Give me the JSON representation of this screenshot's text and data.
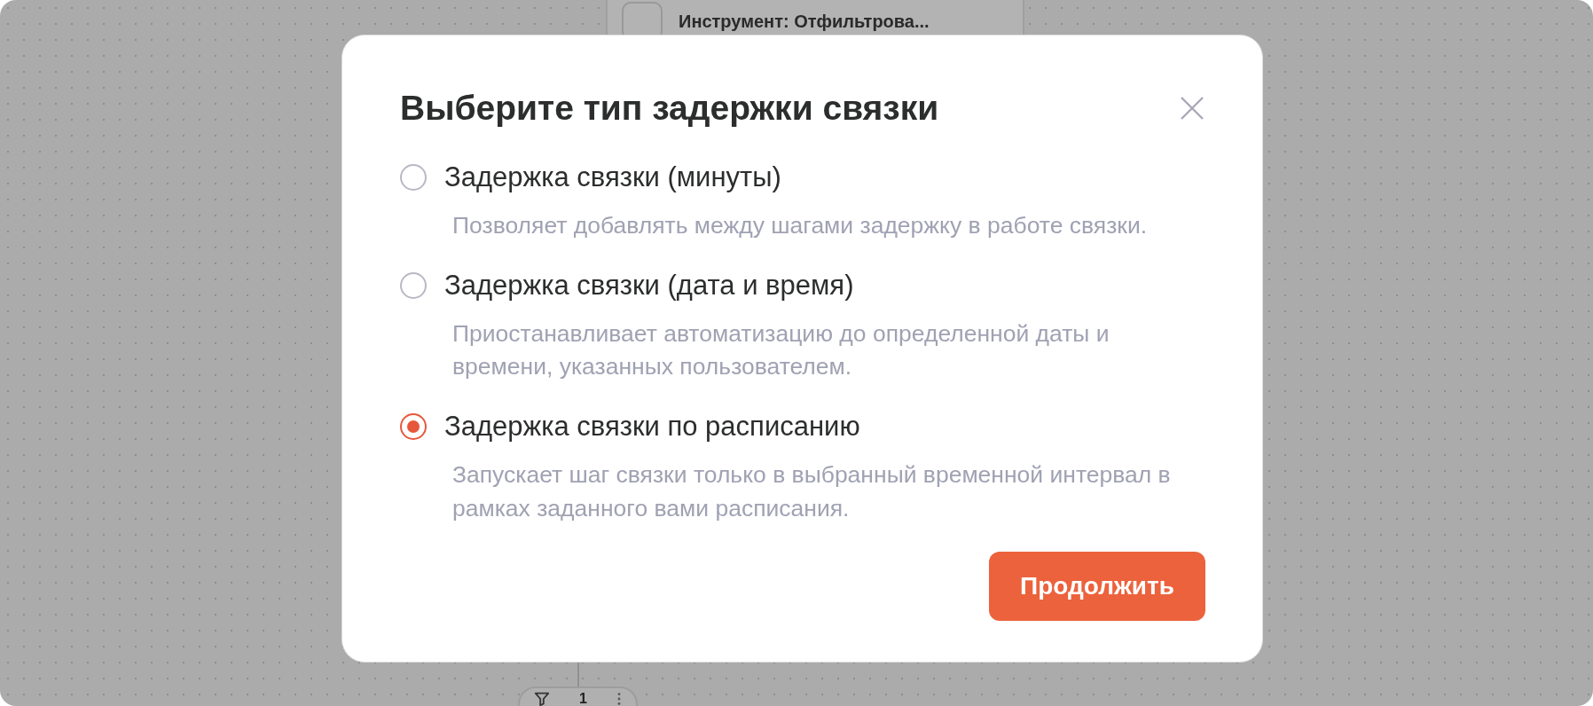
{
  "canvas": {
    "node": {
      "title": "Инструмент: Отфильтрова..."
    },
    "filter_pill": {
      "count": "1"
    }
  },
  "dialog": {
    "title": "Выберите тип задержки связки",
    "options": [
      {
        "label": "Задержка связки (минуты)",
        "description": "Позволяет добавлять между шагами задержку в работе связки.",
        "selected": false
      },
      {
        "label": "Задержка связки (дата и время)",
        "description": "Приостанавливает автоматизацию до определенной даты и времени, указанных пользователем.",
        "selected": false
      },
      {
        "label": "Задержка связки по расписанию",
        "description": "Запускает шаг связки только в выбранный временной интервал в рамках заданного вами расписания.",
        "selected": true
      }
    ],
    "continue_button": "Продолжить"
  }
}
